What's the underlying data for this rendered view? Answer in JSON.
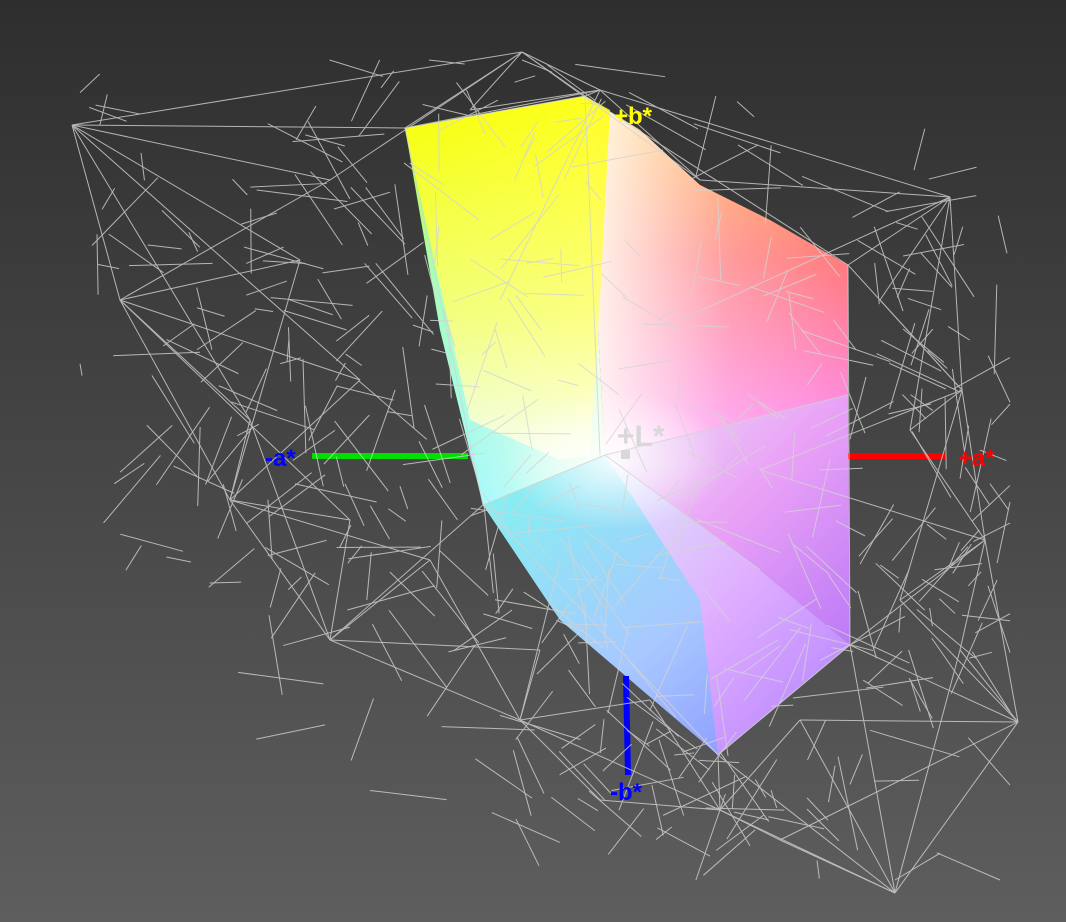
{
  "axes": {
    "plus_b": {
      "label": "+b*",
      "color": "#ffff00"
    },
    "minus_b": {
      "label": "-b*",
      "color": "#0000ff"
    },
    "plus_a": {
      "label": "+a*",
      "color": "#ff0000"
    },
    "minus_a": {
      "label": "-a*",
      "color": "#0000ff"
    },
    "plus_L": {
      "label": "+L*",
      "color": "#d8d8d8"
    }
  },
  "colors": {
    "background_top": "#2e2e2e",
    "background_bottom": "#5e5e5e",
    "wireframe": "#d4d4d4",
    "minus_a_axis_line": "#00e000",
    "plus_a_axis_line": "#ff0000",
    "minus_b_axis_line": "#0000ff"
  }
}
